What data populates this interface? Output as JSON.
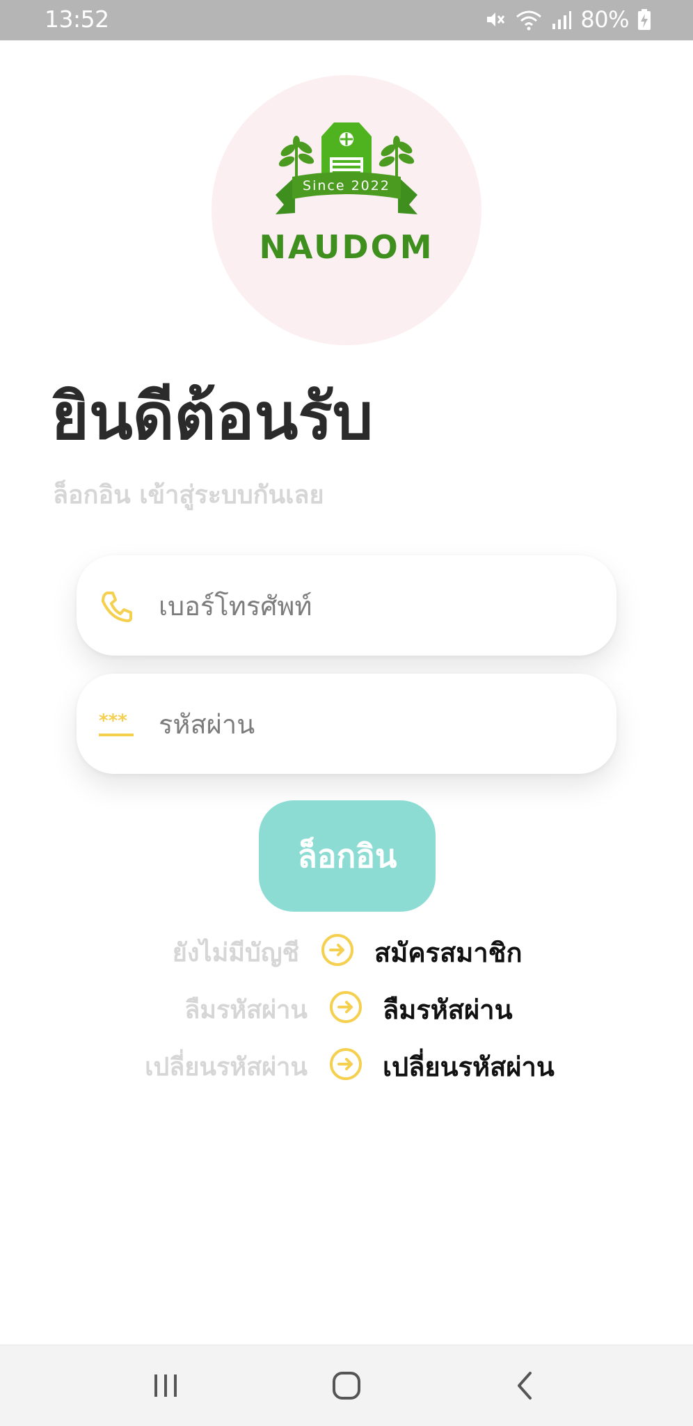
{
  "status_bar": {
    "time": "13:52",
    "battery": "80%",
    "icons": [
      "mute-icon",
      "wifi-icon",
      "signal-icon",
      "battery-charging-icon"
    ]
  },
  "logo": {
    "wordmark": "NAUDOM",
    "since": "Since 2022",
    "colors": {
      "circle": "#fbeff1",
      "green": "#3e8f1e"
    }
  },
  "welcome": {
    "title": "ยินดีต้อนรับ",
    "subtitle": "ล็อกอิน เข้าสู่ระบบกันเลย"
  },
  "form": {
    "phone": {
      "placeholder": "เบอร์โทรศัพท์",
      "value": "",
      "icon": "phone-icon"
    },
    "password": {
      "placeholder": "รหัสผ่าน",
      "value": "",
      "icon": "password-icon"
    },
    "login_label": "ล็อกอิน"
  },
  "links": [
    {
      "prompt": "ยังไม่มีบัญชี",
      "action": "สมัครสมาชิก",
      "icon": "arrow-right-circle-icon"
    },
    {
      "prompt": "ลืมรหัสผ่าน",
      "action": "ลืมรหัสผ่าน",
      "icon": "arrow-right-circle-icon"
    },
    {
      "prompt": "เปลี่ยนรหัสผ่าน",
      "action": "เปลี่ยนรหัสผ่าน",
      "icon": "arrow-right-circle-icon"
    }
  ],
  "colors": {
    "accent": "#8ddcd4",
    "icon_yellow": "#f5cf4e",
    "muted_text": "#d6d6d6"
  },
  "nav_bar": {
    "buttons": [
      "recent-apps-icon",
      "home-icon",
      "back-icon"
    ]
  }
}
